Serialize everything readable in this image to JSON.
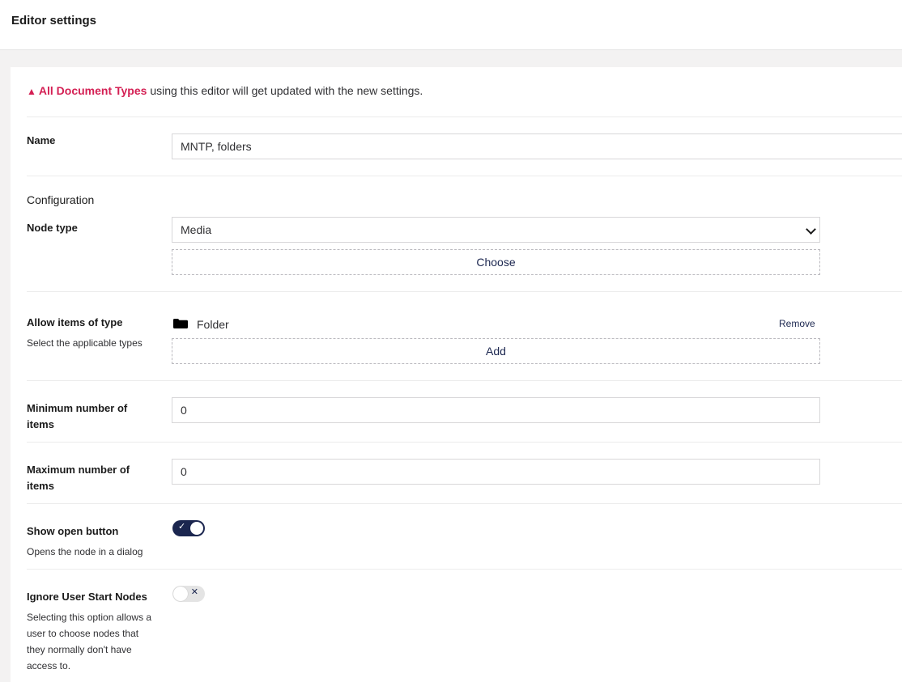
{
  "header": {
    "title": "Editor settings"
  },
  "warning": {
    "icon": "warning-triangle-icon",
    "link_text": "All Document Types",
    "text": " using this editor will get updated with the new settings."
  },
  "name_field": {
    "label": "Name",
    "value": "MNTP, folders"
  },
  "configuration": {
    "title": "Configuration"
  },
  "node_type": {
    "label": "Node type",
    "selected": "Media",
    "choose_label": "Choose"
  },
  "allow_items": {
    "label": "Allow items of type",
    "description": "Select the applicable types",
    "items": [
      {
        "icon": "folder-icon",
        "name": "Folder",
        "remove_label": "Remove"
      }
    ],
    "add_label": "Add"
  },
  "min_items": {
    "label": "Minimum number of items",
    "value": "0"
  },
  "max_items": {
    "label": "Maximum number of items",
    "value": "0"
  },
  "show_open_button": {
    "label": "Show open button",
    "description": "Opens the node in a dialog",
    "enabled": true,
    "on_mark": "✓"
  },
  "ignore_user_start_nodes": {
    "label": "Ignore User Start Nodes",
    "description": "Selecting this option allows a user to choose nodes that they normally don't have access to.",
    "enabled": false,
    "off_mark": "✕"
  },
  "colors": {
    "accent": "#d42054",
    "primary": "#1b264f"
  }
}
